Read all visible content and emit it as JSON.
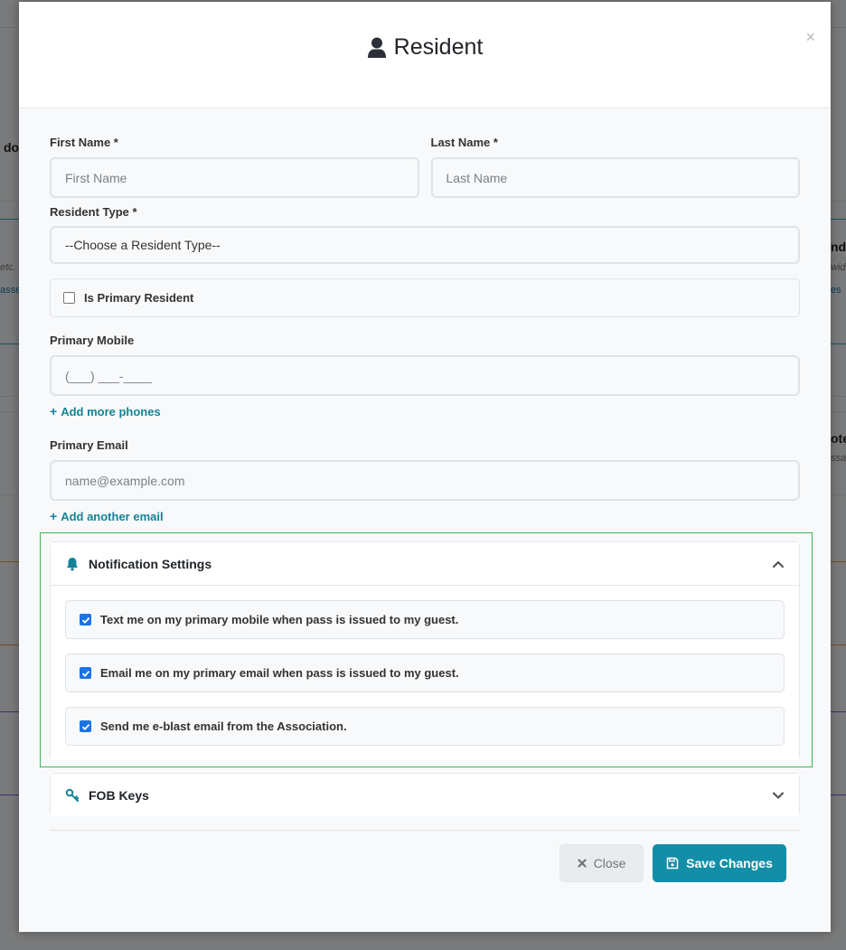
{
  "background": {
    "frag_do": "do",
    "frag_etc": "etc.",
    "frag_asse": "asse",
    "frag_ndo": "ndo",
    "frag_wide": "wid",
    "frag_es": "es",
    "frag_ote": "ote",
    "frag_ssa": "ssa"
  },
  "modal": {
    "title": "Resident",
    "close_glyph": "×"
  },
  "form": {
    "first_name": {
      "label": "First Name *",
      "placeholder": "First Name"
    },
    "last_name": {
      "label": "Last Name *",
      "placeholder": "Last Name"
    },
    "resident_type": {
      "label": "Resident Type *",
      "selected": "--Choose a Resident Type--"
    },
    "primary_resident": {
      "label": "Is Primary Resident",
      "checked": false
    },
    "primary_mobile": {
      "label": "Primary Mobile",
      "placeholder": "(___) ___-____"
    },
    "add_phones": "Add more phones",
    "primary_email": {
      "label": "Primary Email",
      "placeholder": "name@example.com"
    },
    "add_email": "Add another email"
  },
  "notifications": {
    "title": "Notification Settings",
    "items": [
      {
        "label": "Text me on my primary mobile when pass is issued to my guest.",
        "checked": true
      },
      {
        "label": "Email me on my primary email when pass is issued to my guest.",
        "checked": true
      },
      {
        "label": "Send me e-blast email from the Association.",
        "checked": true
      }
    ]
  },
  "fob": {
    "title": "FOB Keys"
  },
  "footer": {
    "close_label": "Close",
    "save_label": "Save Changes"
  },
  "colors": {
    "accent": "#138ea8",
    "link": "#138496",
    "checkbox": "#1a73e8",
    "highlight_outline": "#3db35a"
  }
}
